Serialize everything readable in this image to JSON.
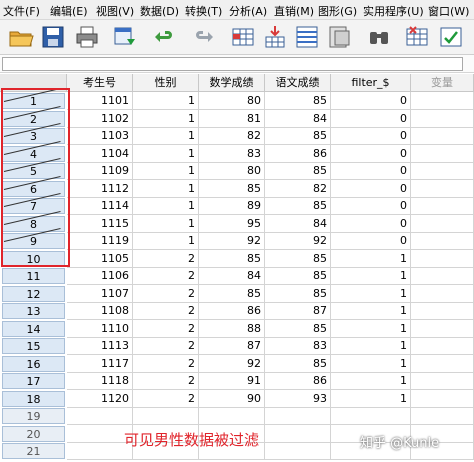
{
  "menu": [
    {
      "label": "文件(F)"
    },
    {
      "label": "编辑(E)"
    },
    {
      "label": "视图(V)"
    },
    {
      "label": "数据(D)"
    },
    {
      "label": "转换(T)"
    },
    {
      "label": "分析(A)"
    },
    {
      "label": "直销(M)"
    },
    {
      "label": "图形(G)"
    },
    {
      "label": "实用程序(U)"
    },
    {
      "label": "窗口(W)"
    }
  ],
  "toolbar": [
    "open-folder",
    "save",
    "print",
    "dialog-recall",
    "undo",
    "redo",
    "goto-case",
    "goto-variable",
    "variables",
    "data-editor",
    "find",
    "insert-cases",
    "weight-cases"
  ],
  "columns": [
    "考生号",
    "性别",
    "数学成绩",
    "语文成绩",
    "filter_$",
    "变量"
  ],
  "rows": [
    {
      "label": "1",
      "id": "1101",
      "gender": "1",
      "math": "80",
      "chinese": "85",
      "filter": "0",
      "filtered": true
    },
    {
      "label": "2",
      "id": "1102",
      "gender": "1",
      "math": "81",
      "chinese": "84",
      "filter": "0",
      "filtered": true
    },
    {
      "label": "3",
      "id": "1103",
      "gender": "1",
      "math": "82",
      "chinese": "85",
      "filter": "0",
      "filtered": true
    },
    {
      "label": "4",
      "id": "1104",
      "gender": "1",
      "math": "83",
      "chinese": "86",
      "filter": "0",
      "filtered": true
    },
    {
      "label": "5",
      "id": "1109",
      "gender": "1",
      "math": "80",
      "chinese": "85",
      "filter": "0",
      "filtered": true
    },
    {
      "label": "6",
      "id": "1112",
      "gender": "1",
      "math": "85",
      "chinese": "82",
      "filter": "0",
      "filtered": true
    },
    {
      "label": "7",
      "id": "1114",
      "gender": "1",
      "math": "89",
      "chinese": "85",
      "filter": "0",
      "filtered": true
    },
    {
      "label": "8",
      "id": "1115",
      "gender": "1",
      "math": "95",
      "chinese": "84",
      "filter": "0",
      "filtered": true
    },
    {
      "label": "9",
      "id": "1119",
      "gender": "1",
      "math": "92",
      "chinese": "92",
      "filter": "0",
      "filtered": true
    },
    {
      "label": "10",
      "id": "1105",
      "gender": "2",
      "math": "85",
      "chinese": "85",
      "filter": "1",
      "filtered": false
    },
    {
      "label": "11",
      "id": "1106",
      "gender": "2",
      "math": "84",
      "chinese": "85",
      "filter": "1",
      "filtered": false
    },
    {
      "label": "12",
      "id": "1107",
      "gender": "2",
      "math": "85",
      "chinese": "85",
      "filter": "1",
      "filtered": false
    },
    {
      "label": "13",
      "id": "1108",
      "gender": "2",
      "math": "86",
      "chinese": "87",
      "filter": "1",
      "filtered": false
    },
    {
      "label": "14",
      "id": "1110",
      "gender": "2",
      "math": "88",
      "chinese": "85",
      "filter": "1",
      "filtered": false
    },
    {
      "label": "15",
      "id": "1113",
      "gender": "2",
      "math": "87",
      "chinese": "83",
      "filter": "1",
      "filtered": false
    },
    {
      "label": "16",
      "id": "1117",
      "gender": "2",
      "math": "92",
      "chinese": "85",
      "filter": "1",
      "filtered": false
    },
    {
      "label": "17",
      "id": "1118",
      "gender": "2",
      "math": "91",
      "chinese": "86",
      "filter": "1",
      "filtered": false
    },
    {
      "label": "18",
      "id": "1120",
      "gender": "2",
      "math": "90",
      "chinese": "93",
      "filter": "1",
      "filtered": false
    },
    {
      "label": "19",
      "id": "",
      "gender": "",
      "math": "",
      "chinese": "",
      "filter": "",
      "filtered": false
    },
    {
      "label": "20",
      "id": "",
      "gender": "",
      "math": "",
      "chinese": "",
      "filter": "",
      "filtered": false
    },
    {
      "label": "21",
      "id": "",
      "gender": "",
      "math": "",
      "chinese": "",
      "filter": "",
      "filtered": false
    }
  ],
  "annotation": "可见男性数据被过滤",
  "watermark": "知乎 @Kunle",
  "colors": {
    "accent": "#e0242b",
    "rowHeader": "#dce8f5"
  }
}
